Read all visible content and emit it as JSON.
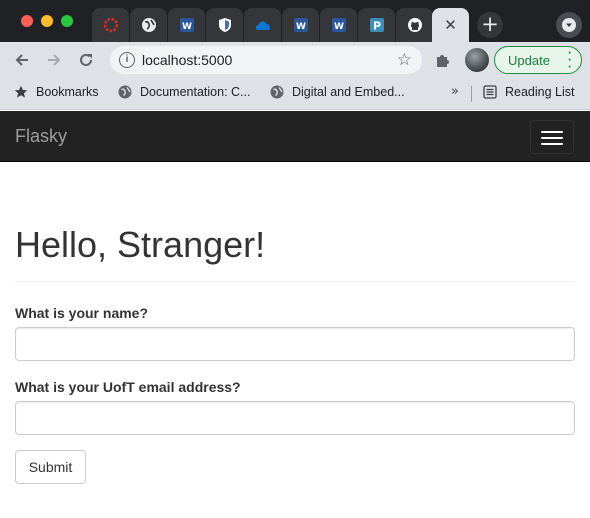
{
  "browser": {
    "tabs": [
      {
        "icon": "red-circle-favicon",
        "color": "#d93025"
      },
      {
        "icon": "globe-favicon",
        "color": "#ffffff"
      },
      {
        "icon": "word-favicon",
        "color": "#2b579a"
      },
      {
        "icon": "shield-favicon",
        "color": "#4a6fa5"
      },
      {
        "icon": "onedrive-favicon",
        "color": "#0f78d4"
      },
      {
        "icon": "word-favicon",
        "color": "#2b579a"
      },
      {
        "icon": "word-favicon",
        "color": "#2b579a"
      },
      {
        "icon": "p-favicon",
        "color": "#3d8eb9"
      },
      {
        "icon": "github-favicon",
        "color": "#ffffff"
      },
      {
        "icon": "close-icon",
        "active": true
      }
    ],
    "new_tab_symbol": "+",
    "address": "localhost:5000",
    "update_label": "Update",
    "bookmarks": [
      {
        "icon": "star-icon",
        "label": "Bookmarks"
      },
      {
        "icon": "globe-icon",
        "label": "Documentation: C..."
      },
      {
        "icon": "globe-icon",
        "label": "Digital and Embed..."
      }
    ],
    "overflow_symbol": "»",
    "reading_list_label": "Reading List"
  },
  "page": {
    "brand": "Flasky",
    "heading": "Hello, Stranger!",
    "fields": [
      {
        "label": "What is your name?",
        "value": ""
      },
      {
        "label": "What is your UofT email address?",
        "value": ""
      }
    ],
    "submit_label": "Submit"
  },
  "colors": {
    "navbar": "#222222",
    "brand_text": "#9d9d9d",
    "update_green": "#188038"
  }
}
